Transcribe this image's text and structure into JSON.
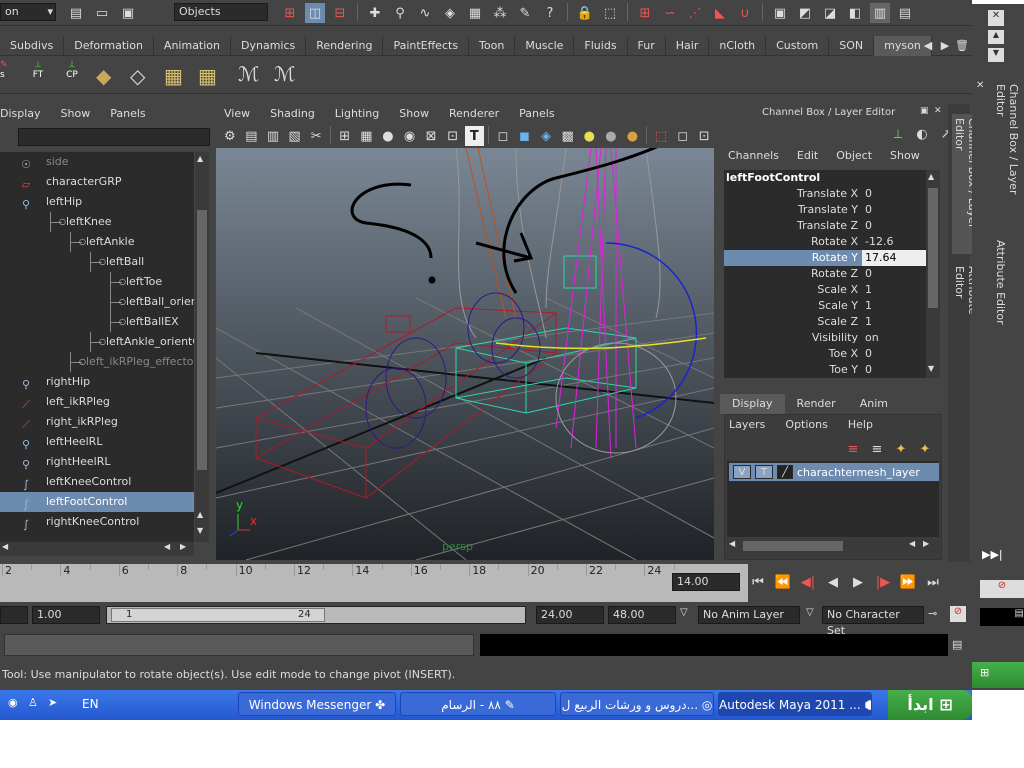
{
  "status_line": {
    "selector_value": "Objects",
    "left_stub": "on"
  },
  "shelf": {
    "tabs": [
      "Subdivs",
      "Deformation",
      "Animation",
      "Dynamics",
      "Rendering",
      "PaintEffects",
      "Toon",
      "Muscle",
      "Fluids",
      "Fur",
      "Hair",
      "nCloth",
      "Custom",
      "SON",
      "myson"
    ],
    "active": "myson",
    "icon_labels": [
      "FT",
      "CP",
      "s"
    ]
  },
  "outliner": {
    "menu": [
      "Display",
      "Show",
      "Panels"
    ],
    "items": [
      {
        "label": "side",
        "icon": "camera-icon",
        "indent": 0,
        "dim": true
      },
      {
        "label": "characterGRP",
        "icon": "group-icon",
        "indent": 0
      },
      {
        "label": "leftHip",
        "icon": "joint-icon",
        "indent": 0
      },
      {
        "label": "leftKnee",
        "icon": "",
        "indent": 1
      },
      {
        "label": "leftAnkle",
        "icon": "",
        "indent": 2
      },
      {
        "label": "leftBall",
        "icon": "",
        "indent": 3
      },
      {
        "label": "leftToe",
        "icon": "",
        "indent": 4
      },
      {
        "label": "leftBall_orientC",
        "icon": "",
        "indent": 4
      },
      {
        "label": "leftBallEX",
        "icon": "",
        "indent": 4
      },
      {
        "label": "leftAnkle_orientCo",
        "icon": "",
        "indent": 3
      },
      {
        "label": "left_ikRPleg_effector",
        "icon": "",
        "indent": 2,
        "dim": true
      },
      {
        "label": "rightHip",
        "icon": "joint-icon",
        "indent": 0
      },
      {
        "label": "left_ikRPleg",
        "icon": "ik-icon",
        "indent": 0
      },
      {
        "label": "right_ikRPleg",
        "icon": "ik-icon",
        "indent": 0
      },
      {
        "label": "leftHeelRL",
        "icon": "joint-icon",
        "indent": 0
      },
      {
        "label": "rightHeelRL",
        "icon": "joint-icon",
        "indent": 0
      },
      {
        "label": "leftKneeControl",
        "icon": "curve-icon",
        "indent": 0
      },
      {
        "label": "leftFootControl",
        "icon": "curve-icon",
        "indent": 0,
        "selected": true
      },
      {
        "label": "rightKneeControl",
        "icon": "curve-icon",
        "indent": 0
      }
    ]
  },
  "viewport": {
    "menu": [
      "View",
      "Shading",
      "Lighting",
      "Show",
      "Renderer",
      "Panels"
    ],
    "camera_label": "persp",
    "axis": {
      "x": "x",
      "y": "y"
    }
  },
  "channel_box": {
    "title": "Channel Box / Layer Editor",
    "menu": [
      "Channels",
      "Edit",
      "Object",
      "Show"
    ],
    "object_name": "leftFootControl",
    "channels": [
      {
        "name": "Translate X",
        "value": "0"
      },
      {
        "name": "Translate Y",
        "value": "0"
      },
      {
        "name": "Translate Z",
        "value": "0"
      },
      {
        "name": "Rotate X",
        "value": "-12.6"
      },
      {
        "name": "Rotate Y",
        "value": "17.64",
        "selected": true
      },
      {
        "name": "Rotate Z",
        "value": "0"
      },
      {
        "name": "Scale X",
        "value": "1"
      },
      {
        "name": "Scale Y",
        "value": "1"
      },
      {
        "name": "Scale Z",
        "value": "1"
      },
      {
        "name": "Visibility",
        "value": "on"
      },
      {
        "name": "Toe X",
        "value": "0"
      },
      {
        "name": "Toe Y",
        "value": "0"
      }
    ]
  },
  "layer_editor": {
    "tabs": [
      "Display",
      "Render",
      "Anim"
    ],
    "active_tab": "Display",
    "menu": [
      "Layers",
      "Options",
      "Help"
    ],
    "layer": {
      "v": "V",
      "t": "T",
      "name": "charachtermesh_layer"
    }
  },
  "side_tabs": [
    "Channel Box / Layer Editor",
    "Attribute Editor"
  ],
  "timeline": {
    "ticks": [
      "2",
      "4",
      "6",
      "8",
      "10",
      "12",
      "14",
      "16",
      "18",
      "20",
      "22",
      "24"
    ],
    "current_time": "14.00"
  },
  "range": {
    "start": "1.00",
    "slider_start": "1",
    "slider_end": "24",
    "end": "24.00",
    "total": "48.00",
    "anim_layer": "No Anim Layer",
    "char_set": "No Character Set"
  },
  "help_line": "Tool: Use manipulator to rotate object(s). Use edit mode to change pivot (INSERT).",
  "taskbar": {
    "lang": "EN",
    "items": [
      "Windows Messenger",
      "٨٨ - الرسام",
      "دروس و ورشات الربيع ل...",
      "Autodesk Maya 2011 ..."
    ],
    "start": "ابدأ"
  },
  "right_window": {
    "tabs": [
      "Channel Box / Layer Editor",
      "Attribute Editor"
    ]
  },
  "colors": {
    "selection": "#6d8aaf",
    "ui_bg": "#444444",
    "field_bg": "#2b2b2b"
  }
}
